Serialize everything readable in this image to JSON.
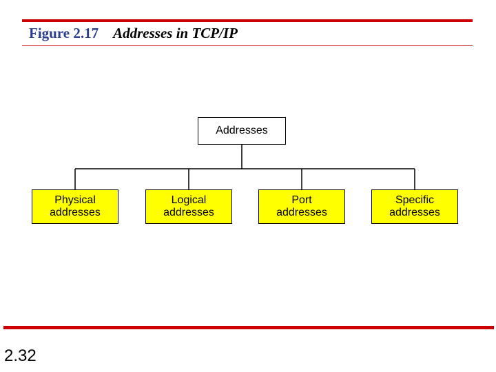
{
  "figure": {
    "number": "Figure 2.17",
    "title": "Addresses in TCP/IP"
  },
  "diagram": {
    "root": {
      "line1": "Addresses"
    },
    "children": [
      {
        "line1": "Physical",
        "line2": "addresses"
      },
      {
        "line1": "Logical",
        "line2": "addresses"
      },
      {
        "line1": "Port",
        "line2": "addresses"
      },
      {
        "line1": "Specific",
        "line2": "addresses"
      }
    ]
  },
  "page_number": "2.32"
}
